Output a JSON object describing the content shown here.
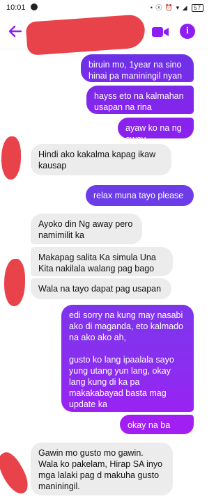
{
  "status_bar": {
    "time": "10:01",
    "icons": "• ⓧ ⏰ ▾ ◢",
    "battery": "57"
  },
  "header": {
    "back_icon": "arrow-left-icon",
    "video_icon": "video-camera-icon",
    "info_icon": "info-icon",
    "info_glyph": "i",
    "accent": "#8e1df2"
  },
  "messages": [
    {
      "side": "out",
      "text": "biruin mo, 1year na sino hinai pa maniningil nyan"
    },
    {
      "side": "out",
      "text": "hayss eto na kalmahan usapan na rina"
    },
    {
      "side": "out",
      "text": "ayaw ko na ng away"
    },
    {
      "side": "in",
      "text": "Hindi ako kakalma kapag ikaw kausap"
    },
    {
      "side": "out",
      "text": "relax muna tayo please"
    },
    {
      "side": "in",
      "text": "Ayoko din Ng away pero namimilit ka"
    },
    {
      "side": "in",
      "text": "Makapag salita Ka simula Una Kita nakilala walang pag bago"
    },
    {
      "side": "in",
      "text": "Wala na tayo dapat pag usapan"
    },
    {
      "side": "out",
      "paragraphs": [
        "edi sorry na kung may nasabi ako di maganda,  eto kalmado na ako ako ah,",
        "gusto ko lang ipaalala sayo yung utang yun lang, okay lang kung di ka pa makakabayad basta mag update ka"
      ]
    },
    {
      "side": "out",
      "text": "okay na ba yan"
    },
    {
      "side": "in",
      "text": "Gawin mo gusto mo gawin. Wala ko pakelam, Hirap SA inyo mga lalaki pag d makuha gusto maniningil."
    }
  ]
}
